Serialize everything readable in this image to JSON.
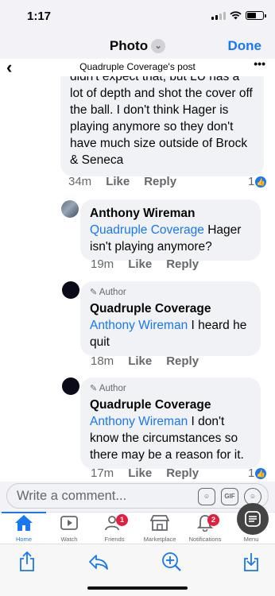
{
  "status": {
    "time": "1:17"
  },
  "nav": {
    "title": "Photo",
    "done": "Done"
  },
  "post": {
    "title": "Quadruple Coverage's post"
  },
  "comments": [
    {
      "text": "didn't expect that, but LU has a lot of depth and shot the cover off the ball. I don't think Hager is playing anymore so they don't have much size outside of Brock & Seneca",
      "time": "34m",
      "like": "Like",
      "reply": "Reply",
      "likes": "1"
    },
    {
      "name": "Anthony Wireman",
      "mention": "Quadruple Coverage",
      "text": " Hager isn't playing anymore?",
      "time": "19m",
      "like": "Like",
      "reply": "Reply"
    },
    {
      "badge": "Author",
      "name": "Quadruple Coverage",
      "mention": "Anthony Wireman",
      "text": " I heard he quit",
      "time": "18m",
      "like": "Like",
      "reply": "Reply"
    },
    {
      "badge": "Author",
      "name": "Quadruple Coverage",
      "mention": "Anthony Wireman",
      "text": " I don't know the circumstances so there may be a reason for it.",
      "time": "17m",
      "like": "Like",
      "reply": "Reply",
      "likes": "1"
    }
  ],
  "composer": {
    "placeholder": "Write a comment...",
    "gif": "GIF"
  },
  "tabs": [
    {
      "label": "Home",
      "icon": "home-icon"
    },
    {
      "label": "Watch",
      "icon": "watch-icon"
    },
    {
      "label": "Friends",
      "icon": "friends-icon",
      "badge": "1"
    },
    {
      "label": "Marketplace",
      "icon": "marketplace-icon"
    },
    {
      "label": "Notifications",
      "icon": "bell-icon",
      "badge": "2"
    },
    {
      "label": "Menu",
      "icon": "menu-icon"
    }
  ],
  "colors": {
    "accent": "#1877f2",
    "badge": "#e41e3f",
    "bubble": "#f0f2f5"
  }
}
